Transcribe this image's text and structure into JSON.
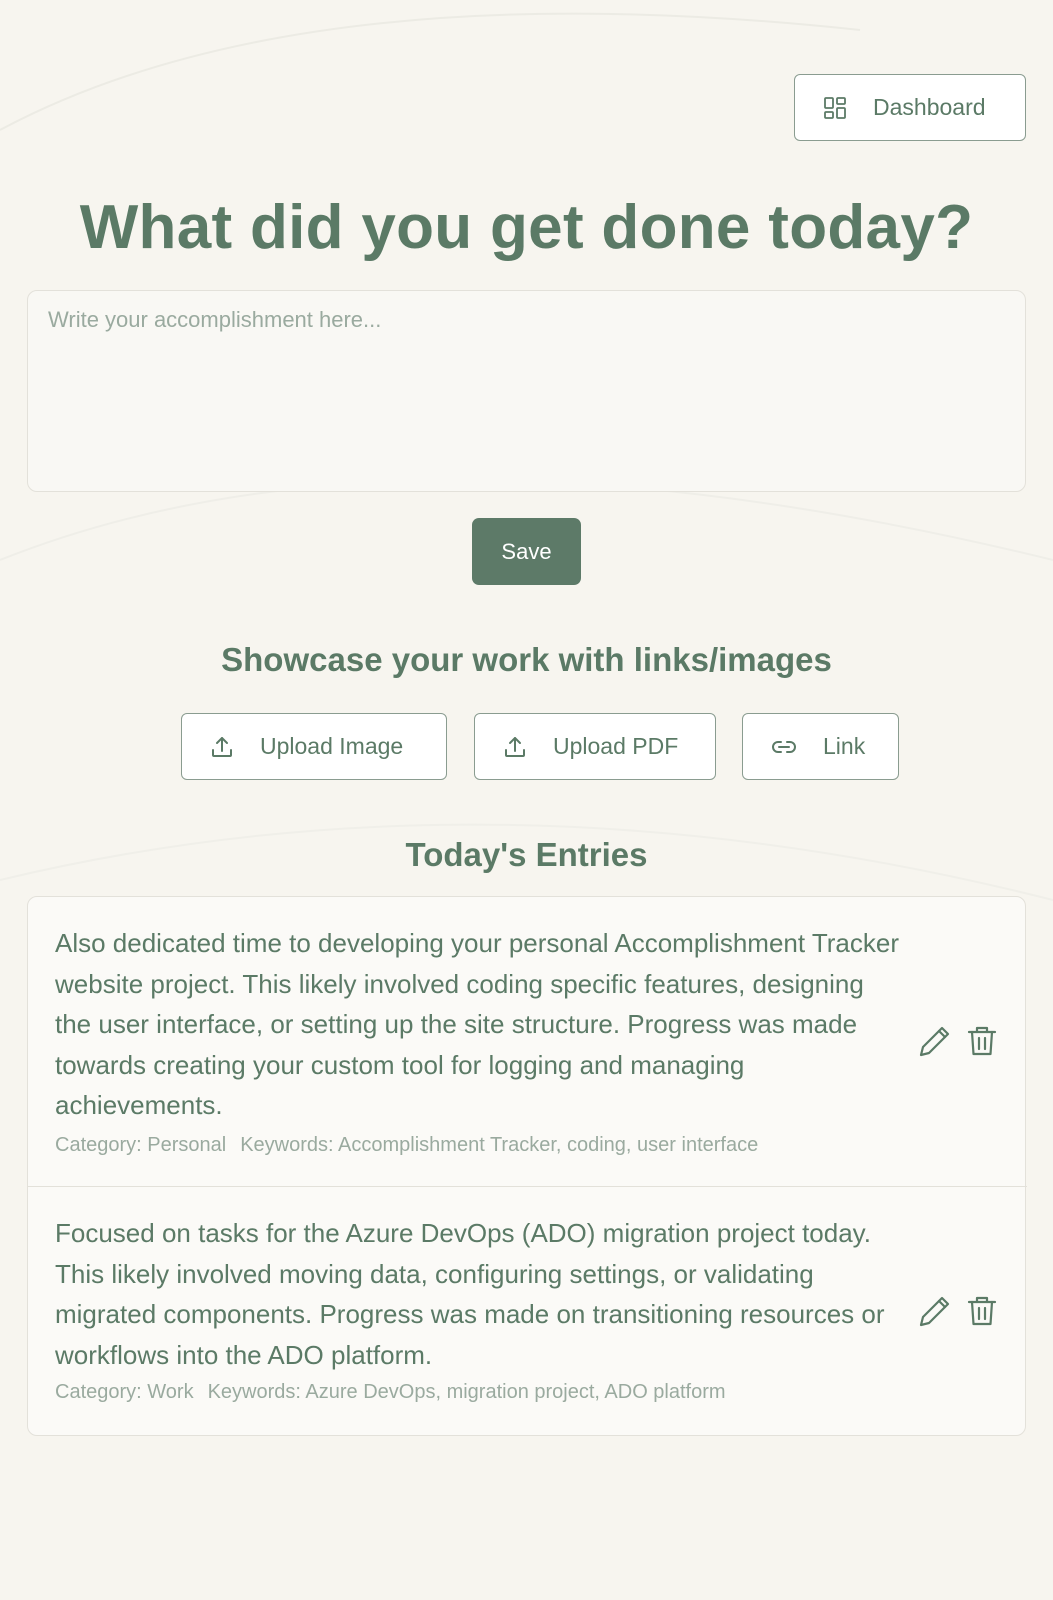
{
  "header": {
    "dashboard_label": "Dashboard",
    "dashboard_icon": "dashboard-grid-icon"
  },
  "main": {
    "title": "What did you get done today?",
    "input_placeholder": "Write your accomplishment here...",
    "input_value": "",
    "save_label": "Save"
  },
  "showcase": {
    "title": "Showcase your work with links/images",
    "buttons": [
      {
        "label": "Upload Image",
        "icon": "upload-icon"
      },
      {
        "label": "Upload PDF",
        "icon": "upload-icon"
      },
      {
        "label": "Link",
        "icon": "link-icon"
      }
    ]
  },
  "entries": {
    "title": "Today's Entries",
    "items": [
      {
        "text": "Also dedicated time to developing your personal Accomplishment Tracker website project. This likely involved coding specific features, designing the user interface, or setting up the site structure. Progress was made towards creating your custom tool for logging and managing achievements.",
        "category": "Category: Personal",
        "keywords": "Keywords: Accomplishment Tracker, coding, user interface"
      },
      {
        "text": "Focused on tasks for the Azure DevOps (ADO) migration project today. This likely involved moving data, configuring settings, or validating migrated components. Progress was made on transitioning resources or workflows into the ADO platform.",
        "category": "Category: Work",
        "keywords": "Keywords: Azure DevOps, migration project, ADO platform"
      }
    ]
  },
  "colors": {
    "background": "#f7f5ef",
    "primary": "#5d7a68",
    "text": "#5b7a66",
    "muted": "#9aaa9f",
    "border": "#e3e1da"
  }
}
